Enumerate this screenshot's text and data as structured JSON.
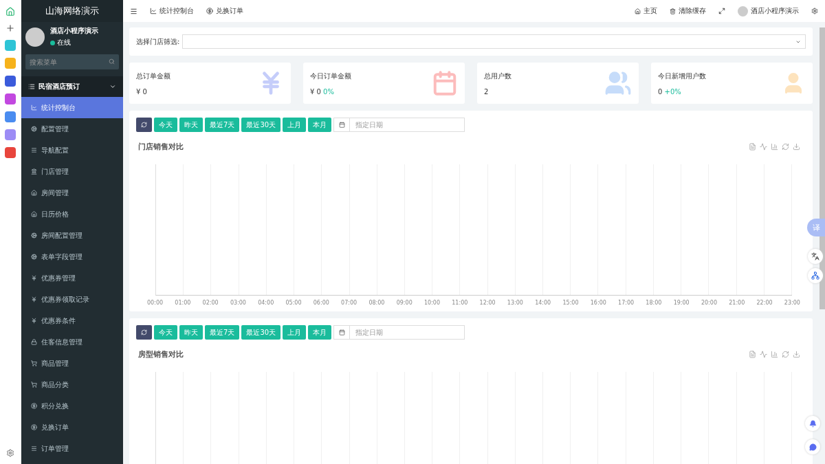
{
  "brand": "山海网络演示",
  "user": {
    "name": "酒店小程序演示",
    "status": "在线"
  },
  "menu_search": {
    "placeholder": "搜索菜单"
  },
  "menu_group": {
    "label": "民宿酒店预订",
    "expanded": true
  },
  "menu_items": [
    {
      "label": "统计控制台",
      "selected": true
    },
    {
      "label": "配置管理",
      "selected": false
    },
    {
      "label": "导航配置",
      "selected": false
    },
    {
      "label": "门店管理",
      "selected": false
    },
    {
      "label": "房间管理",
      "selected": false
    },
    {
      "label": "日历价格",
      "selected": false
    },
    {
      "label": "房间配置管理",
      "selected": false
    },
    {
      "label": "表单字段管理",
      "selected": false
    },
    {
      "label": "优惠券管理",
      "selected": false
    },
    {
      "label": "优惠券领取记录",
      "selected": false
    },
    {
      "label": "优惠券条件",
      "selected": false
    },
    {
      "label": "住客信息管理",
      "selected": false
    },
    {
      "label": "商品管理",
      "selected": false
    },
    {
      "label": "商品分类",
      "selected": false
    },
    {
      "label": "积分兑换",
      "selected": false
    },
    {
      "label": "兑换订单",
      "selected": false
    },
    {
      "label": "订单管理",
      "selected": false
    }
  ],
  "top_tabs": [
    {
      "label": "统计控制台"
    },
    {
      "label": "兑换订单"
    }
  ],
  "top_right": {
    "home": "主页",
    "clear_cache": "清除缓存",
    "user": "酒店小程序演示"
  },
  "store_filter": {
    "label": "选择门店筛选:"
  },
  "stats": [
    {
      "title": "总订单金额",
      "value": "¥ 0",
      "kind": "yen"
    },
    {
      "title": "今日订单金额",
      "value": "¥ 0",
      "change": "0%",
      "kind": "calendar"
    },
    {
      "title": "总用户数",
      "value": "2",
      "kind": "users"
    },
    {
      "title": "今日新增用户数",
      "value": "0",
      "change": "+0%",
      "kind": "user"
    }
  ],
  "charts": [
    {
      "title": "门店销售对比",
      "ranges": [
        "今天",
        "昨天",
        "最近7天",
        "最近30天",
        "上月",
        "本月"
      ],
      "date_placeholder": "指定日期",
      "x_labels": [
        "00:00",
        "01:00",
        "02:00",
        "03:00",
        "04:00",
        "05:00",
        "06:00",
        "07:00",
        "08:00",
        "09:00",
        "10:00",
        "11:00",
        "12:00",
        "13:00",
        "14:00",
        "15:00",
        "16:00",
        "17:00",
        "18:00",
        "19:00",
        "20:00",
        "21:00",
        "22:00",
        "23:00"
      ]
    },
    {
      "title": "房型销售对比",
      "ranges": [
        "今天",
        "昨天",
        "最近7天",
        "最近30天",
        "上月",
        "本月"
      ],
      "date_placeholder": "指定日期"
    }
  ],
  "side_widgets": {
    "translate": "译"
  }
}
